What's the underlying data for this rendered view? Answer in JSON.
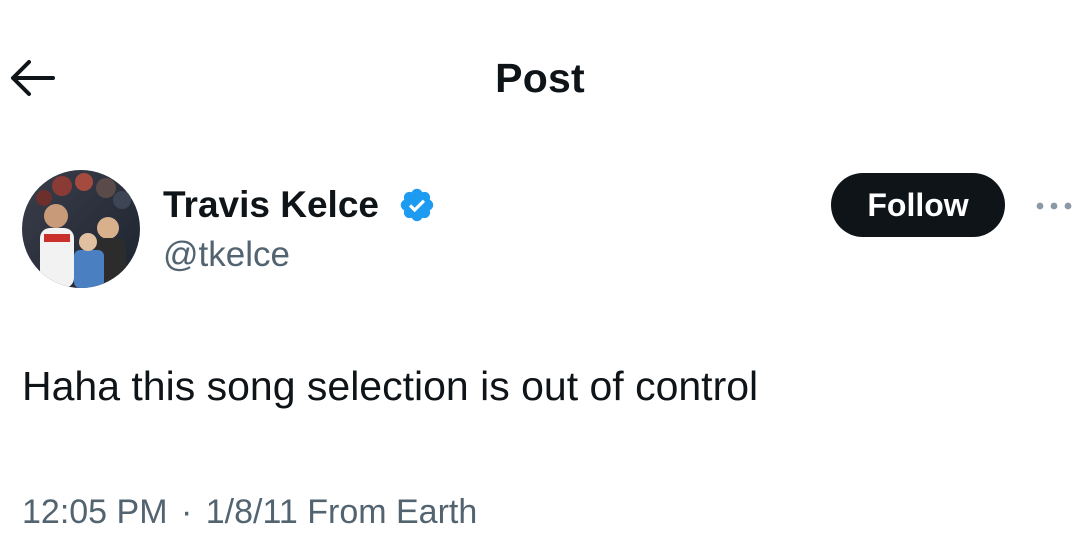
{
  "header": {
    "back_icon": "arrow-left-icon",
    "title": "Post"
  },
  "author": {
    "name": "Travis Kelce",
    "handle": "@tkelce",
    "verified_icon": "verified-badge-icon",
    "avatar": "avatar-photo",
    "follow_label": "Follow",
    "more_icon": "more-horizontal-icon"
  },
  "post": {
    "text": "Haha this song selection is out of control",
    "time": "12:05 PM",
    "separator": "·",
    "date": "1/8/11",
    "source": "From Earth"
  },
  "colors": {
    "text_primary": "#0f1419",
    "text_secondary": "#536471",
    "verified_blue": "#1d9bf0",
    "follow_bg": "#0f1419",
    "background": "#ffffff"
  }
}
